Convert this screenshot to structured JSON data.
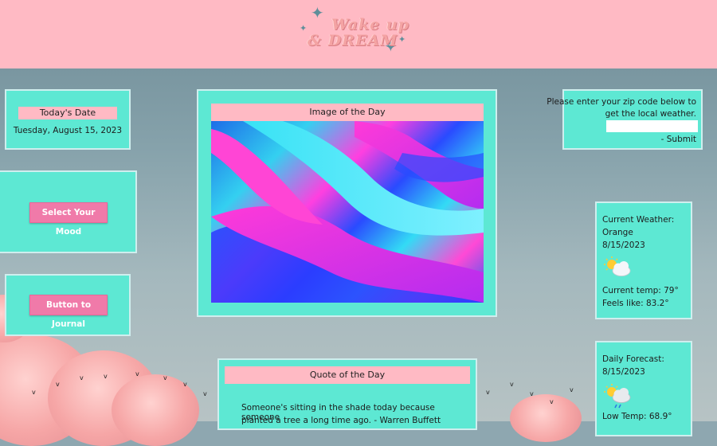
{
  "header": {
    "logo_line1": "Wake up",
    "logo_line2": "& DREAM"
  },
  "date_card": {
    "label": "Today's Date",
    "value": "Tuesday, August 15, 2023"
  },
  "mood_button": {
    "label": "Select Your Mood"
  },
  "journal_button": {
    "label": "Button to Journal"
  },
  "image_card": {
    "label": "Image of the Day"
  },
  "quote_card": {
    "label": "Quote of the Day",
    "line1": "Someone's sitting in the shade today because someone",
    "line2": "planted a tree a long time ago. - Warren Buffett"
  },
  "zip_card": {
    "prompt_line1": "Please enter your zip code below to",
    "prompt_line2": "get the local weather.",
    "input_value": "",
    "submit_label": "- Submit"
  },
  "current_weather": {
    "title": "Current Weather:",
    "city": "Orange",
    "date": "8/15/2023",
    "icon": "partly-cloudy-icon",
    "temp": "Current temp: 79°",
    "feels": "Feels like: 83.2°"
  },
  "daily_forecast": {
    "title": "Daily Forecast:",
    "date": "8/15/2023",
    "icon": "sun-cloud-rain-icon",
    "low": "Low Temp: 68.9°"
  },
  "colors": {
    "header": "#ffbac4",
    "card": "#5de8d3",
    "button": "#f07aa9"
  }
}
